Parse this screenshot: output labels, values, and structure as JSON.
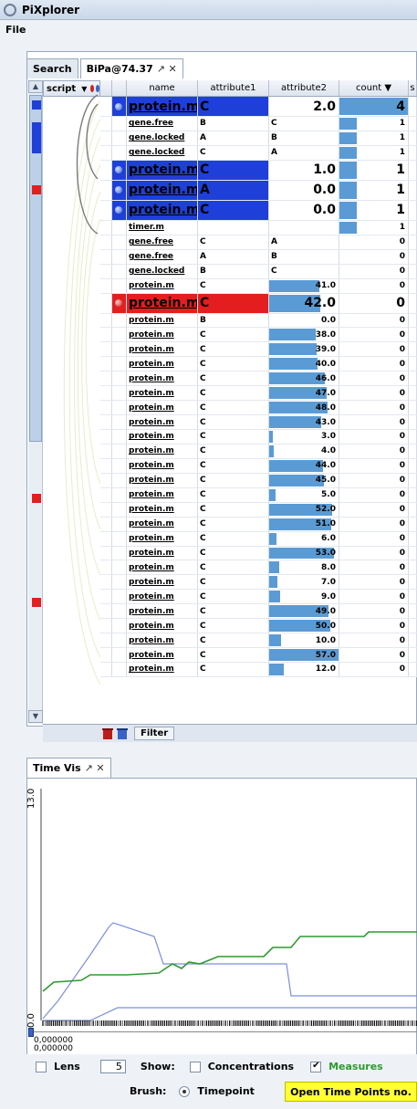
{
  "window": {
    "title": "PiXplorer",
    "menu": [
      "File"
    ]
  },
  "top_tabs": [
    {
      "label": "Search"
    },
    {
      "label": "BiPa@74.37",
      "controls": "↗ ✕"
    }
  ],
  "table": {
    "script_header": "script",
    "columns": {
      "name": "name",
      "attribute1": "attribute1",
      "attribute2": "attribute2",
      "count": "count ▼",
      "extra": "s"
    },
    "max_attr2": 57.0,
    "rows": [
      {
        "name": "protein.m",
        "a1": "C",
        "a2": "2.0",
        "count": "4",
        "hl": "blue",
        "big": true,
        "dot": "blue",
        "a2bar": 0,
        "cntbar": 1.0
      },
      {
        "name": "gene.free",
        "a1": "B",
        "a2": "C",
        "count": "1",
        "cntbar": 0.25
      },
      {
        "name": "gene.locked",
        "a1": "A",
        "a2": "B",
        "count": "1",
        "cntbar": 0.25
      },
      {
        "name": "gene.locked",
        "a1": "C",
        "a2": "A",
        "count": "1",
        "cntbar": 0.25
      },
      {
        "name": "protein.m",
        "a1": "C",
        "a2": "1.0",
        "count": "1",
        "hl": "blue",
        "big": true,
        "dot": "blue",
        "cntbar": 0.25
      },
      {
        "name": "protein.m",
        "a1": "A",
        "a2": "0.0",
        "count": "1",
        "hl": "blue",
        "big": true,
        "dot": "blue",
        "cntbar": 0.25
      },
      {
        "name": "protein.m",
        "a1": "C",
        "a2": "0.0",
        "count": "1",
        "hl": "blue",
        "big": true,
        "dot": "blue",
        "cntbar": 0.25
      },
      {
        "name": "timer.m",
        "a1": "",
        "a2": "",
        "count": "1",
        "cntbar": 0.25
      },
      {
        "name": "gene.free",
        "a1": "C",
        "a2": "A",
        "count": "0"
      },
      {
        "name": "gene.free",
        "a1": "A",
        "a2": "B",
        "count": "0"
      },
      {
        "name": "gene.locked",
        "a1": "B",
        "a2": "C",
        "count": "0"
      },
      {
        "name": "protein.m",
        "a1": "C",
        "a2": "41.0",
        "count": "0",
        "num": true
      },
      {
        "name": "protein.m",
        "a1": "C",
        "a2": "42.0",
        "count": "0",
        "hl": "red",
        "big": true,
        "dot": "red",
        "num": true
      },
      {
        "name": "protein.m",
        "a1": "B",
        "a2": "0.0",
        "count": "0",
        "num": true
      },
      {
        "name": "protein.m",
        "a1": "C",
        "a2": "38.0",
        "count": "0",
        "num": true
      },
      {
        "name": "protein.m",
        "a1": "C",
        "a2": "39.0",
        "count": "0",
        "num": true
      },
      {
        "name": "protein.m",
        "a1": "C",
        "a2": "40.0",
        "count": "0",
        "num": true
      },
      {
        "name": "protein.m",
        "a1": "C",
        "a2": "46.0",
        "count": "0",
        "num": true
      },
      {
        "name": "protein.m",
        "a1": "C",
        "a2": "47.0",
        "count": "0",
        "num": true
      },
      {
        "name": "protein.m",
        "a1": "C",
        "a2": "48.0",
        "count": "0",
        "num": true
      },
      {
        "name": "protein.m",
        "a1": "C",
        "a2": "43.0",
        "count": "0",
        "num": true
      },
      {
        "name": "protein.m",
        "a1": "C",
        "a2": "3.0",
        "count": "0",
        "num": true
      },
      {
        "name": "protein.m",
        "a1": "C",
        "a2": "4.0",
        "count": "0",
        "num": true
      },
      {
        "name": "protein.m",
        "a1": "C",
        "a2": "44.0",
        "count": "0",
        "num": true
      },
      {
        "name": "protein.m",
        "a1": "C",
        "a2": "45.0",
        "count": "0",
        "num": true
      },
      {
        "name": "protein.m",
        "a1": "C",
        "a2": "5.0",
        "count": "0",
        "num": true
      },
      {
        "name": "protein.m",
        "a1": "C",
        "a2": "52.0",
        "count": "0",
        "num": true
      },
      {
        "name": "protein.m",
        "a1": "C",
        "a2": "51.0",
        "count": "0",
        "num": true
      },
      {
        "name": "protein.m",
        "a1": "C",
        "a2": "6.0",
        "count": "0",
        "num": true
      },
      {
        "name": "protein.m",
        "a1": "C",
        "a2": "53.0",
        "count": "0",
        "num": true
      },
      {
        "name": "protein.m",
        "a1": "C",
        "a2": "8.0",
        "count": "0",
        "num": true
      },
      {
        "name": "protein.m",
        "a1": "C",
        "a2": "7.0",
        "count": "0",
        "num": true
      },
      {
        "name": "protein.m",
        "a1": "C",
        "a2": "9.0",
        "count": "0",
        "num": true
      },
      {
        "name": "protein.m",
        "a1": "C",
        "a2": "49.0",
        "count": "0",
        "num": true
      },
      {
        "name": "protein.m",
        "a1": "C",
        "a2": "50.0",
        "count": "0",
        "num": true
      },
      {
        "name": "protein.m",
        "a1": "C",
        "a2": "10.0",
        "count": "0",
        "num": true
      },
      {
        "name": "protein.m",
        "a1": "C",
        "a2": "57.0",
        "count": "0",
        "num": true
      },
      {
        "name": "protein.m",
        "a1": "C",
        "a2": "12.0",
        "count": "0",
        "num": true
      }
    ]
  },
  "bottom_toolbar": {
    "filter_label": "Filter"
  },
  "time_vis": {
    "tab_label": "Time Vis",
    "tab_controls": "↗ ✕",
    "y_max_label": "13.0",
    "y_min_label": "0.0",
    "x_start_label": "0,000000\n0,000000"
  },
  "controls": {
    "lens_label": "Lens",
    "lens_value": "5",
    "show_label": "Show:",
    "concentrations_label": "Concentrations",
    "measures_label": "Measures",
    "brush_label": "Brush:",
    "timepoint_label": "Timepoint",
    "open_button_label": "Open Time Points no."
  },
  "colors": {
    "selected_blue": "#1f3fd9",
    "selected_red": "#e41e1e",
    "bar_blue": "#5b9bd5",
    "button_yellow": "#ffff33",
    "measure_green": "#2e9a2e"
  }
}
